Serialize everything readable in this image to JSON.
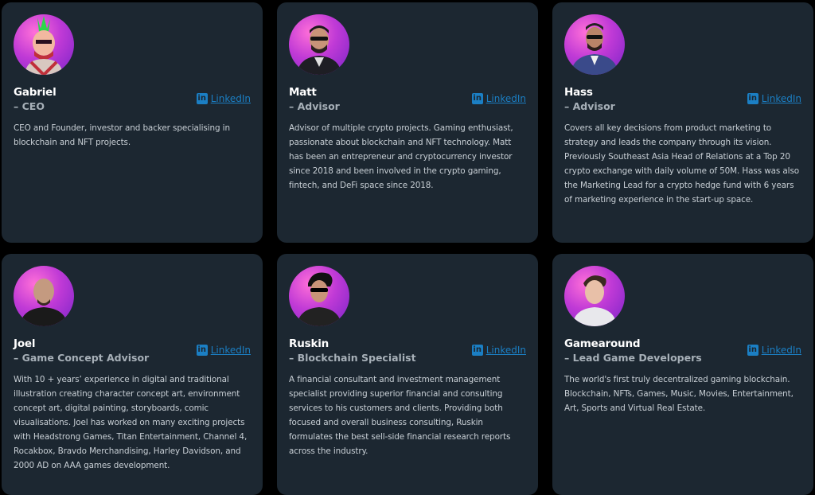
{
  "team": [
    {
      "name": "Gabriel",
      "role": "– CEO",
      "link_label": "LinkedIn",
      "bio": "CEO and Founder, investor and backer specialising in blockchain and NFT projects.",
      "avatar": "gabriel-avatar"
    },
    {
      "name": "Matt",
      "role": "– Advisor",
      "link_label": "LinkedIn",
      "bio": "Advisor of multiple crypto projects. Gaming enthusiast, passionate about blockchain and NFT technology. Matt has been an entrepreneur and cryptocurrency investor since 2018 and been involved in the crypto gaming, fintech, and DeFi space since 2018.",
      "avatar": "matt-avatar"
    },
    {
      "name": "Hass",
      "role": "– Advisor",
      "link_label": "LinkedIn",
      "bio": "Covers all key decisions from product marketing to strategy and leads the company through its vision. Previously Southeast Asia Head of Relations at a Top 20 crypto exchange with daily volume of 50M. Hass was also the Marketing Lead for a crypto hedge fund with 6 years of marketing experience in the start-up space.",
      "avatar": "hass-avatar"
    },
    {
      "name": "Joel",
      "role": "– Game Concept Advisor",
      "link_label": "LinkedIn",
      "bio": "With 10 + years’ experience in digital and traditional illustration creating character concept art, environment concept art, digital painting, storyboards, comic visualisations. Joel has worked on many exciting projects with Headstrong Games, Titan Entertainment, Channel 4, Rocakbox, Bravdo Merchandising, Harley Davidson, and 2000 AD on AAA games development.",
      "avatar": "joel-avatar"
    },
    {
      "name": "Ruskin",
      "role": "– Blockchain Specialist",
      "link_label": "LinkedIn",
      "bio": "A financial consultant and investment management specialist providing superior financial and consulting services to his customers and clients. Providing both focused and overall business consulting, Ruskin formulates the best sell-side financial research reports across the industry.",
      "avatar": "ruskin-avatar"
    },
    {
      "name": "Gamearound",
      "role": "– Lead Game Developers",
      "link_label": "LinkedIn",
      "bio": "The world's first truly decentralized gaming blockchain. Blockchain, NFTs, Games, Music, Movies, Entertainment, Art, Sports and Virtual Real Estate.",
      "avatar": "gamearound-avatar"
    }
  ],
  "colors": {
    "page_bg": "#000000",
    "card_bg": "#1c2731",
    "link": "#1b7fc4",
    "role": "#a7b0b8",
    "bio": "#c8cfd5",
    "avatar_gradient_start": "#ff6fd8",
    "avatar_gradient_end": "#7a24c8"
  },
  "icons": {
    "link_icon": "linkedin-icon"
  }
}
